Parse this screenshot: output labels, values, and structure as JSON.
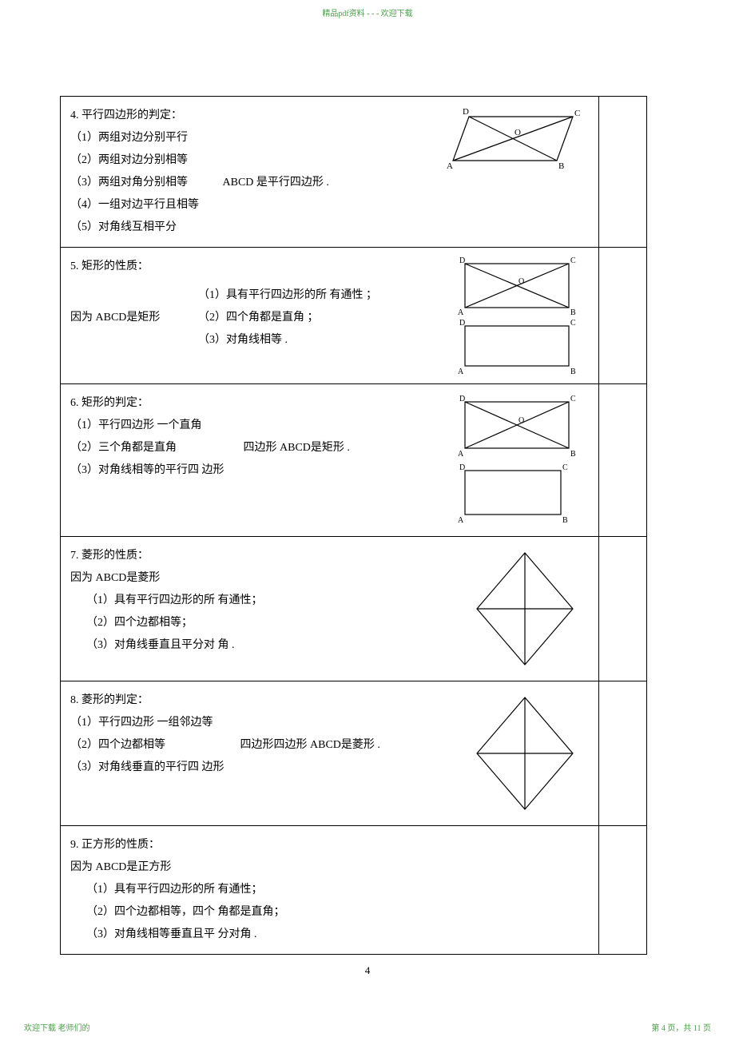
{
  "header": "精品pdf资料 - - - 欢迎下载",
  "sections": {
    "s4": {
      "title": "4. 平行四边形的判定：",
      "item1": "（1）两组对边分别平行",
      "item2": "（2）两组对边分别相等",
      "item3": "（3）两组对角分别相等",
      "conclusion": "ABCD 是平行四边形   .",
      "item4": "（4）一组对边平行且相等",
      "item5": "（5）对角线互相平分",
      "labels": {
        "A": "A",
        "B": "B",
        "C": "C",
        "D": "D",
        "O": "O"
      }
    },
    "s5": {
      "title": "5. 矩形的性质：",
      "lead": "因为 ABCD是矩形",
      "p1": "（1）具有平行四边形的所   有通性 ；",
      "p2": "（2）四个角都是直角   ；",
      "p3": "（3）对角线相等   .",
      "labels": {
        "A": "A",
        "B": "B",
        "C": "C",
        "D": "D",
        "O": "O"
      }
    },
    "s6": {
      "title": "6.  矩形的判定：",
      "item1": "（1）平行四边形        一个直角",
      "item2": "（2）三个角都是直角",
      "conclusion": "四边形 ABCD是矩形 .",
      "item3": "（3）对角线相等的平行四    边形",
      "labels": {
        "A": "A",
        "B": "B",
        "C": "C",
        "D": "D",
        "O": "O"
      }
    },
    "s7": {
      "title": "7.  菱形的性质：",
      "lead": "因为 ABCD是菱形",
      "p1": "（1）具有平行四边形的所    有通性；",
      "p2": "（2）四个边都相等；",
      "p3": "（3）对角线垂直且平分对    角 ."
    },
    "s8": {
      "title": "8.  菱形的判定：",
      "item1": "（1）平行四边形       一组邻边等",
      "item2": "（2）四个边都相等",
      "conclusion": "四边形四边形   ABCD是菱形 .",
      "item3": "（3）对角线垂直的平行四    边形"
    },
    "s9": {
      "title": "9.  正方形的性质：",
      "lead": "因为 ABCD是正方形",
      "p1": "（1）具有平行四边形的所    有通性；",
      "p2": "（2）四个边都相等，四个    角都是直角；",
      "p3": "（3）对角线相等垂直且平    分对角  ."
    }
  },
  "pageNum": "4",
  "footerLeft": "欢迎下载   老师们的",
  "footerRight": "第 4 页，共 11 页"
}
